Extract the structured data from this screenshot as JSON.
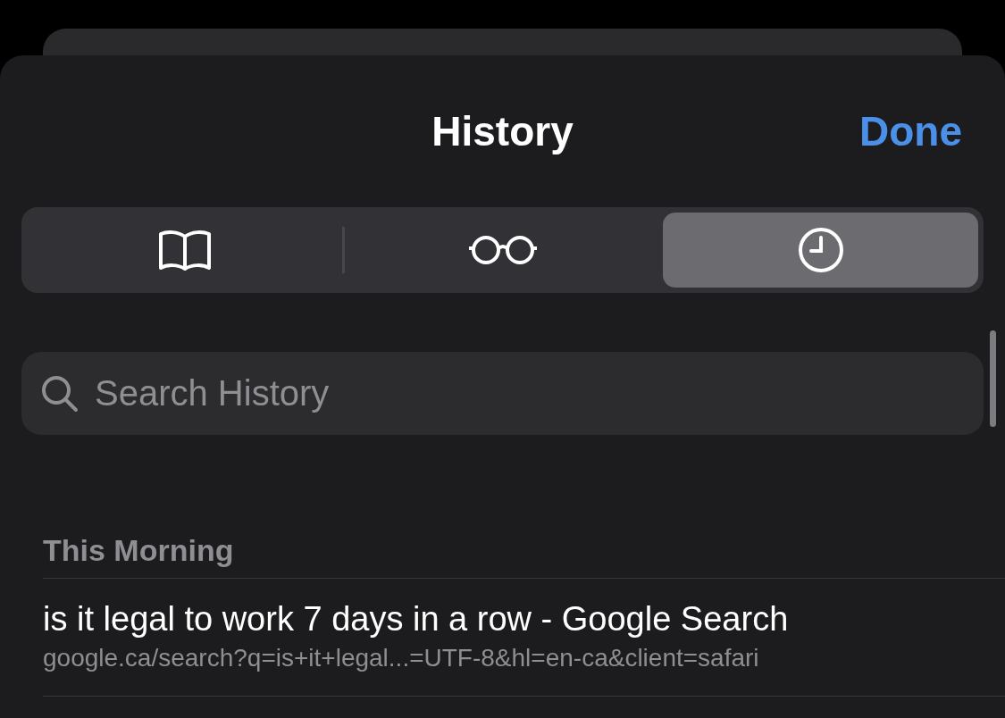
{
  "header": {
    "title": "History",
    "done": "Done"
  },
  "tabs": [
    {
      "kind": "bookmarks",
      "selected": false
    },
    {
      "kind": "reading-list",
      "selected": false
    },
    {
      "kind": "history",
      "selected": true
    }
  ],
  "search": {
    "placeholder": "Search History"
  },
  "sections": [
    {
      "title": "This Morning",
      "items": [
        {
          "title": "is it legal to work 7 days in a row - Google Search",
          "url": "google.ca/search?q=is+it+legal...=UTF-8&hl=en-ca&client=safari"
        }
      ]
    }
  ]
}
